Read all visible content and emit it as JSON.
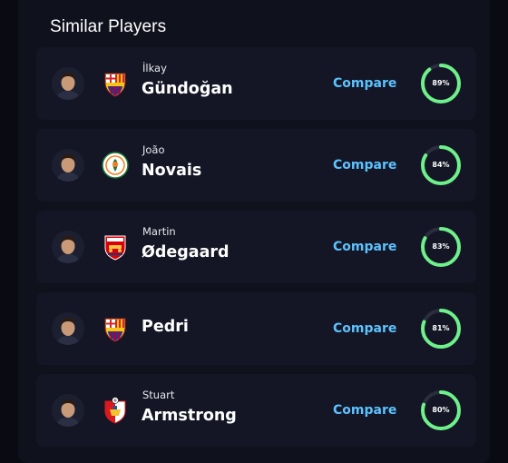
{
  "section": {
    "title": "Similar Players",
    "action_label": "Compare"
  },
  "colors": {
    "ring_fill": "#6ef08a",
    "ring_track": "#2a2d3d",
    "compare_link": "#5cc2ff"
  },
  "players": [
    {
      "first_name": "İlkay",
      "last_name": "Gündoğan",
      "similarity": 0.89,
      "similarity_label": "89%",
      "club_badge": "barcelona-badge"
    },
    {
      "first_name": "João",
      "last_name": "Novais",
      "similarity": 0.84,
      "similarity_label": "84%",
      "club_badge": "alanyaspor-badge"
    },
    {
      "first_name": "Martin",
      "last_name": "Ødegaard",
      "similarity": 0.83,
      "similarity_label": "83%",
      "club_badge": "arsenal-badge"
    },
    {
      "first_name": "",
      "last_name": "Pedri",
      "similarity": 0.81,
      "similarity_label": "81%",
      "club_badge": "barcelona-badge"
    },
    {
      "first_name": "Stuart",
      "last_name": "Armstrong",
      "similarity": 0.8,
      "similarity_label": "80%",
      "club_badge": "southampton-badge"
    }
  ]
}
